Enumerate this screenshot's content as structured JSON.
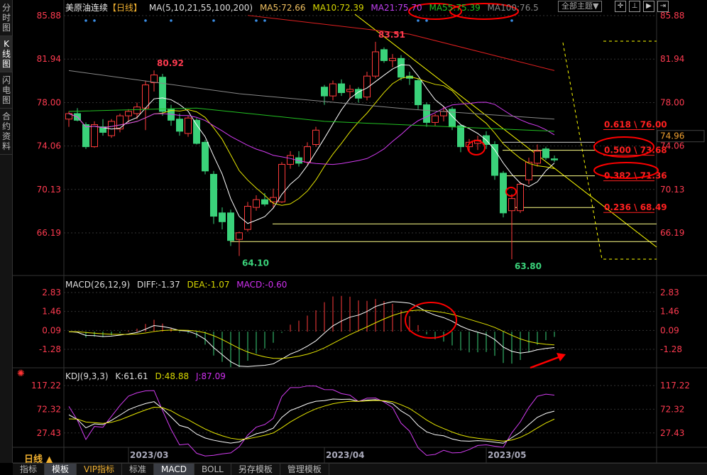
{
  "sidebar": {
    "tabs": [
      "分时图",
      "K线图",
      "闪电图",
      "合约资料"
    ]
  },
  "header": {
    "title": "美原油连续",
    "period_tag": "【日线】",
    "ma_params": "MA(5,10,21,55,100,200)",
    "ma5": "MA5:72.66",
    "ma10": "MA10:72.39",
    "ma21": "MA21:75.70",
    "ma55": "MA55:75.39",
    "ma100": "MA100:76.5",
    "theme_button": "全部主题▼"
  },
  "macd_header": {
    "name": "MACD(26,12,9)",
    "diff": "DIFF:-1.37",
    "dea": "DEA:-1.07",
    "macd": "MACD:-0.60"
  },
  "kdj_header": {
    "name": "KDJ(9,3,3)",
    "k": "K:61.61",
    "d": "D:48.88",
    "j": "J:87.09"
  },
  "period_label": "日线 ▲",
  "bottom_tabs": [
    "指标",
    "模板",
    "VIP指标",
    "标准",
    "MACD",
    "BOLL",
    "另存模板",
    "管理模板"
  ],
  "colors": {
    "up": "#ff3b3b",
    "down": "#3ad27a",
    "ma5": "#ffffff",
    "ma10": "#e6e600",
    "ma21": "#d23cf0",
    "ma55": "#22c022",
    "ma100": "#888888",
    "ma200": "#e02020",
    "fib": "#ffff00",
    "anno": "#ff0000"
  },
  "chart_data": {
    "type": "candlestick",
    "price_axis": {
      "ticks": [
        "85.88",
        "81.94",
        "78.00",
        "74.06",
        "70.13",
        "66.19"
      ],
      "ylim": [
        64.0,
        86.5
      ],
      "current": "74.96"
    },
    "macd_axis": {
      "ticks": [
        "2.83",
        "1.46",
        "0.09",
        "-1.28"
      ],
      "ylim": [
        -2.1,
        3.3
      ]
    },
    "kdj_axis": {
      "ticks": [
        "117.22",
        "72.32",
        "27.43"
      ],
      "ylim": [
        -20,
        140
      ]
    },
    "x_labels": [
      {
        "label": "2023/03",
        "index": 9
      },
      {
        "label": "2023/04",
        "index": 32
      },
      {
        "label": "2023/05",
        "index": 51
      }
    ],
    "ohlc": [
      [
        76.5,
        77.2,
        75.8,
        77.0
      ],
      [
        77.0,
        77.5,
        76.3,
        76.4
      ],
      [
        76.0,
        76.2,
        73.8,
        74.0
      ],
      [
        74.0,
        76.3,
        73.9,
        76.0
      ],
      [
        75.8,
        76.5,
        75.0,
        75.3
      ],
      [
        75.0,
        76.5,
        74.8,
        76.3
      ],
      [
        75.6,
        77.0,
        75.3,
        76.8
      ],
      [
        76.8,
        77.4,
        76.2,
        77.2
      ],
      [
        77.0,
        78.0,
        76.5,
        77.6
      ],
      [
        77.5,
        80.0,
        75.5,
        79.6
      ],
      [
        79.8,
        80.92,
        79.0,
        80.5
      ],
      [
        80.3,
        80.6,
        76.8,
        77.2
      ],
      [
        77.4,
        77.8,
        75.9,
        76.4
      ],
      [
        76.5,
        77.0,
        75.0,
        75.4
      ],
      [
        75.2,
        76.8,
        74.9,
        76.6
      ],
      [
        76.4,
        76.6,
        74.2,
        74.3
      ],
      [
        74.4,
        74.6,
        71.5,
        71.8
      ],
      [
        71.5,
        71.8,
        67.0,
        67.7
      ],
      [
        68.0,
        68.5,
        66.5,
        67.2
      ],
      [
        68.0,
        68.3,
        65.0,
        65.5
      ],
      [
        65.6,
        66.3,
        64.1,
        66.2
      ],
      [
        66.5,
        69.0,
        66.3,
        68.6
      ],
      [
        68.5,
        69.6,
        68.2,
        69.2
      ],
      [
        69.2,
        69.8,
        68.6,
        68.8
      ],
      [
        69.0,
        70.2,
        68.5,
        69.4
      ],
      [
        69.0,
        72.6,
        68.9,
        72.4
      ],
      [
        72.4,
        73.6,
        72.0,
        73.2
      ],
      [
        73.0,
        73.6,
        72.2,
        72.5
      ],
      [
        72.6,
        74.4,
        72.4,
        74.0
      ],
      [
        74.2,
        75.8,
        74.0,
        75.5
      ],
      [
        79.4,
        79.6,
        77.8,
        78.6
      ],
      [
        78.6,
        80.0,
        78.2,
        79.7
      ],
      [
        79.7,
        80.1,
        78.6,
        78.9
      ],
      [
        79.0,
        79.6,
        78.4,
        79.2
      ],
      [
        79.2,
        79.4,
        78.0,
        78.4
      ],
      [
        78.5,
        80.8,
        78.2,
        80.4
      ],
      [
        80.4,
        83.51,
        80.2,
        82.6
      ],
      [
        82.8,
        83.0,
        81.6,
        81.8
      ],
      [
        81.8,
        82.4,
        81.2,
        82.0
      ],
      [
        82.0,
        82.3,
        80.0,
        80.3
      ],
      [
        80.4,
        80.8,
        79.6,
        80.2
      ],
      [
        80.0,
        80.2,
        77.4,
        77.8
      ],
      [
        77.8,
        78.0,
        75.8,
        76.2
      ],
      [
        76.2,
        77.0,
        75.9,
        76.8
      ],
      [
        76.8,
        77.6,
        76.3,
        77.2
      ],
      [
        77.4,
        77.6,
        75.5,
        75.8
      ],
      [
        75.9,
        76.0,
        73.5,
        74.0
      ],
      [
        74.0,
        74.7,
        73.6,
        74.4
      ],
      [
        74.3,
        75.0,
        73.7,
        74.6
      ],
      [
        75.0,
        75.4,
        73.8,
        74.2
      ],
      [
        74.2,
        74.5,
        71.0,
        71.4
      ],
      [
        71.6,
        71.8,
        67.6,
        68.0
      ],
      [
        68.2,
        69.7,
        63.8,
        69.3
      ],
      [
        68.2,
        70.8,
        68.0,
        70.6
      ],
      [
        71.0,
        73.0,
        70.6,
        72.6
      ],
      [
        72.5,
        74.2,
        72.2,
        73.6
      ],
      [
        73.8,
        74.0,
        72.8,
        73.0
      ],
      [
        72.9,
        73.2,
        72.6,
        72.8
      ]
    ],
    "long_mas": {
      "ma200": [
        [
          21,
          85.9
        ],
        [
          40,
          84.2
        ],
        [
          57,
          80.9
        ]
      ],
      "ma100": [
        [
          0,
          80.9
        ],
        [
          20,
          78.8
        ],
        [
          40,
          77.4
        ],
        [
          57,
          76.5
        ]
      ],
      "ma55": [
        [
          0,
          77.2
        ],
        [
          15,
          77.5
        ],
        [
          30,
          76.3
        ],
        [
          45,
          75.8
        ],
        [
          57,
          75.4
        ]
      ]
    },
    "annotations": {
      "high1": {
        "label": "80.92",
        "index": 10
      },
      "low1": {
        "label": "64.10",
        "index": 20
      },
      "high2": {
        "label": "83.51",
        "index": 36
      },
      "low2": {
        "label": "63.80",
        "index": 52
      }
    },
    "fibonacci": [
      {
        "label": "0.618 \\ 76.00",
        "price": 76.0
      },
      {
        "label": "0.500 \\ 73.68",
        "price": 73.68
      },
      {
        "label": "0.382 \\ 71.36",
        "price": 71.36
      },
      {
        "label": "0.236 \\ 68.49",
        "price": 68.49
      }
    ]
  }
}
